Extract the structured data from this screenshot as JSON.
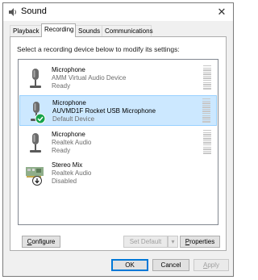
{
  "window": {
    "title": "Sound",
    "close_glyph": "✕"
  },
  "tabs": [
    {
      "label": "Playback",
      "active": false
    },
    {
      "label": "Recording",
      "active": true
    },
    {
      "label": "Sounds",
      "active": false
    },
    {
      "label": "Communications",
      "active": false
    }
  ],
  "panel": {
    "instruction": "Select a recording device below to modify its settings:"
  },
  "devices": [
    {
      "name": "Microphone",
      "sub": "AMM Virtual Audio Device",
      "status": "Ready",
      "icon": "microphone-icon",
      "selected": false
    },
    {
      "name": "Microphone",
      "sub": "AUVMD1F Rocket USB Microphone",
      "status": "Default Device",
      "icon": "microphone-default-icon",
      "selected": true
    },
    {
      "name": "Microphone",
      "sub": "Realtek Audio",
      "status": "Ready",
      "icon": "microphone-icon",
      "selected": false
    },
    {
      "name": "Stereo Mix",
      "sub": "Realtek Audio",
      "status": "Disabled",
      "icon": "sound-card-disabled-icon",
      "selected": false
    }
  ],
  "buttons": {
    "configure": "Configure",
    "set_default": "Set Default",
    "dropdown_glyph": "▾",
    "properties": "Properties",
    "ok": "OK",
    "cancel": "Cancel",
    "apply": "Apply"
  },
  "colors": {
    "selection_bg": "#cce8ff",
    "selection_border": "#99d1ff",
    "default_check": "#16a34a",
    "focus_blue": "#0078d7"
  }
}
